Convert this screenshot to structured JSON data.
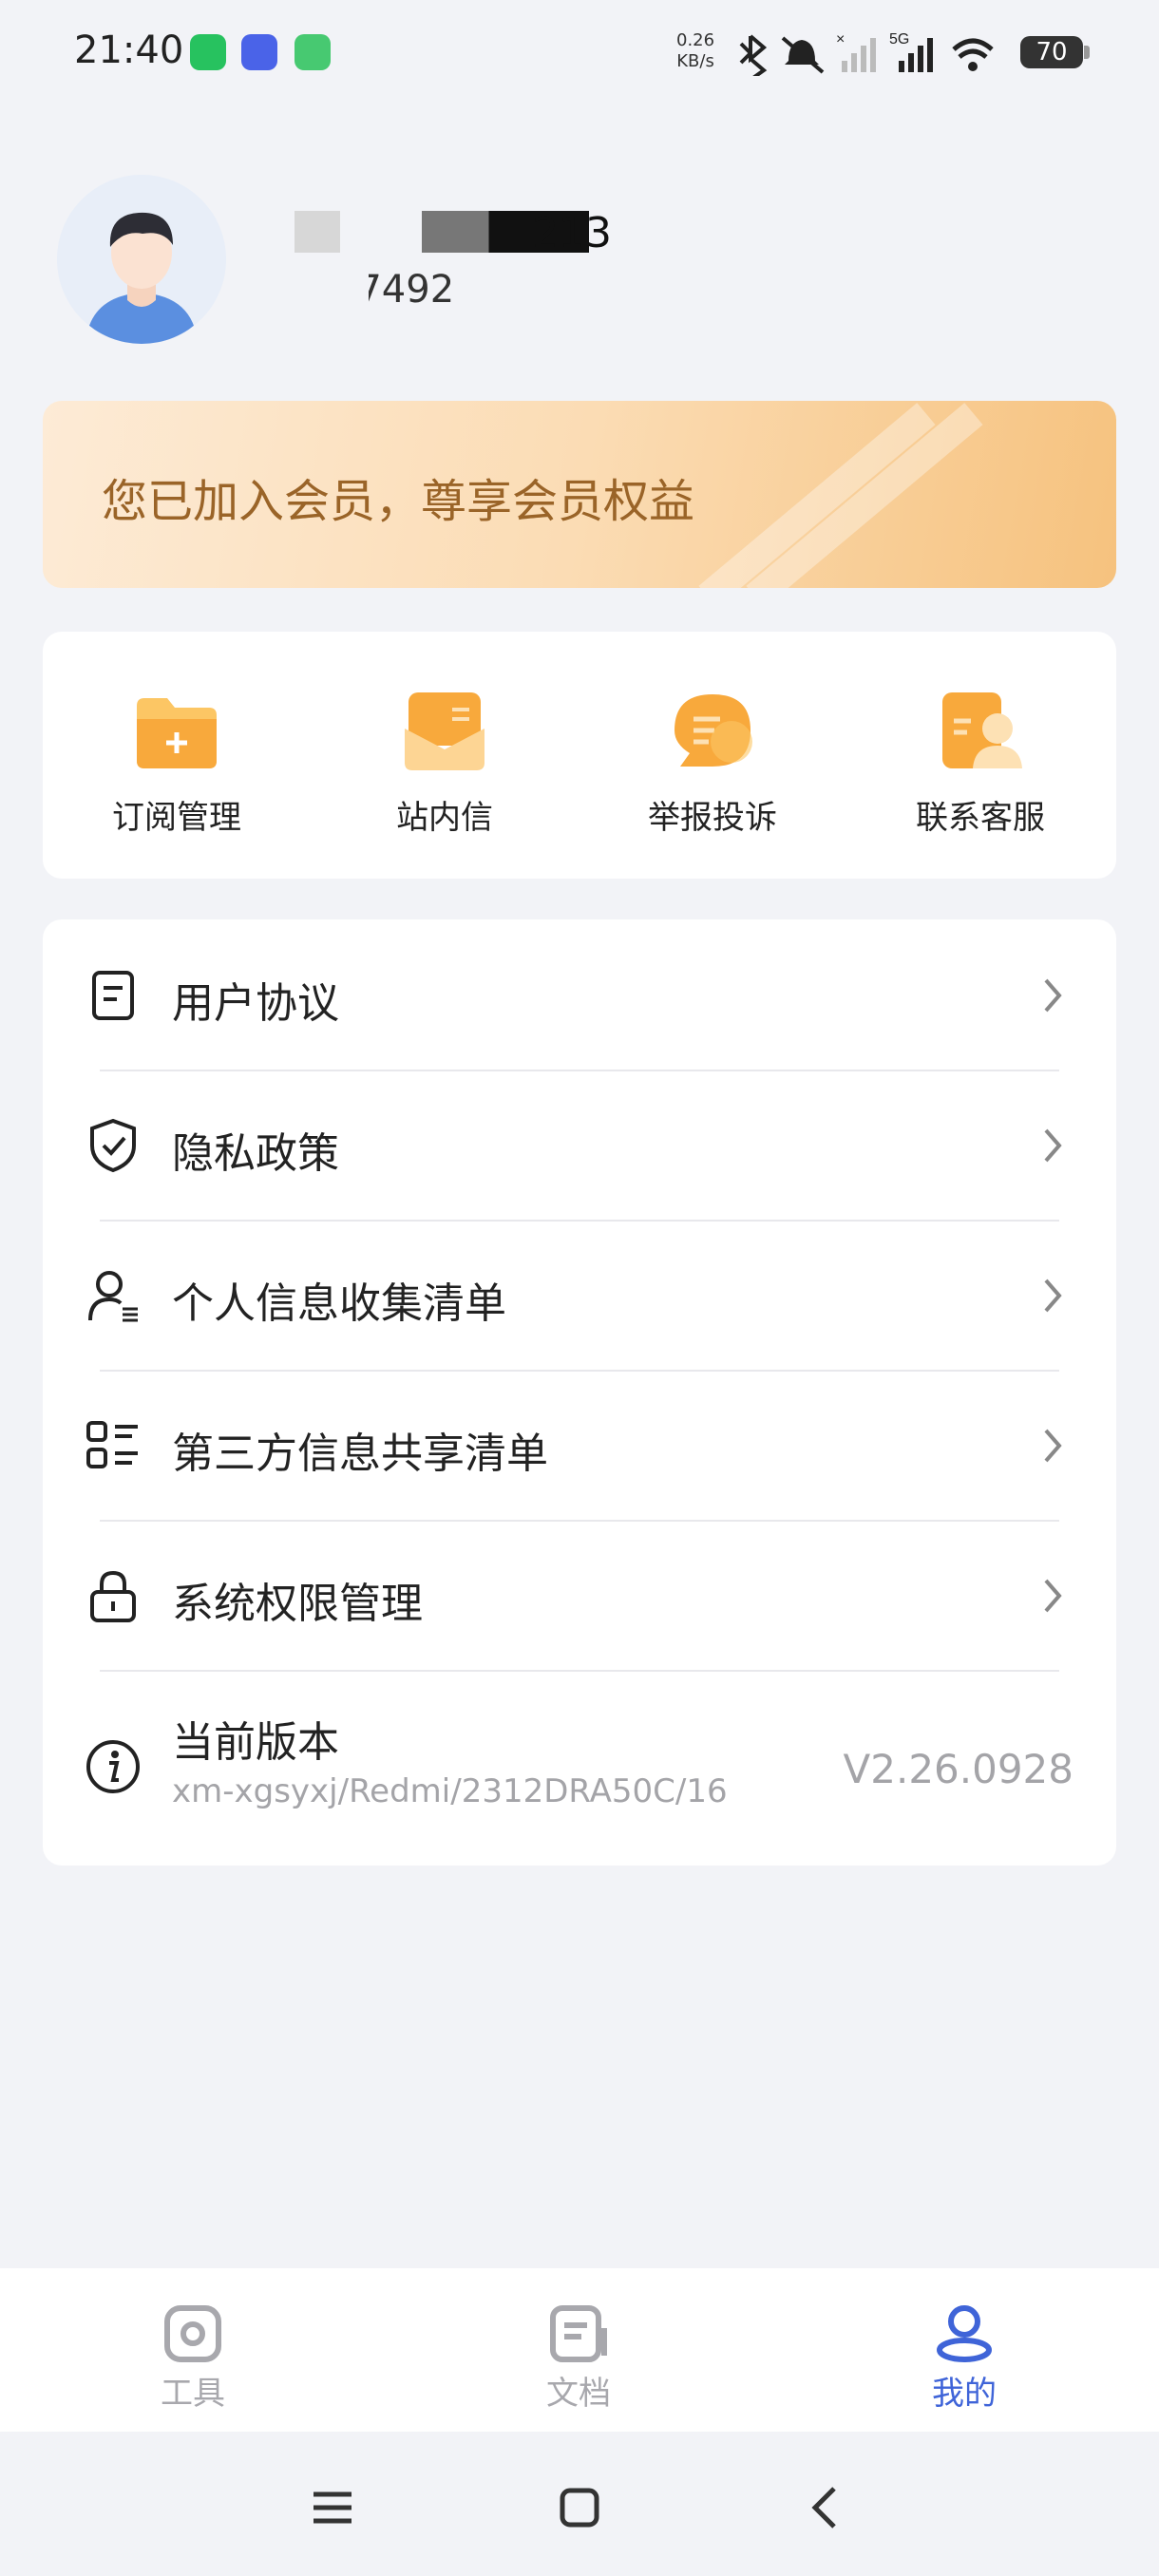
{
  "status_bar": {
    "time": "21:40",
    "net_speed_value": "0.26",
    "net_speed_unit": "KB/s",
    "battery": "70",
    "signal_label": "5G"
  },
  "profile": {
    "name_visible": "213",
    "phone_visible": "1337492"
  },
  "banner": {
    "text": "您已加入会员，尊享会员权益"
  },
  "actions": [
    {
      "label": "订阅管理",
      "icon": "folder-add-icon"
    },
    {
      "label": "站内信",
      "icon": "mail-icon"
    },
    {
      "label": "举报投诉",
      "icon": "chat-bubble-icon"
    },
    {
      "label": "联系客服",
      "icon": "customer-service-icon"
    }
  ],
  "menu": {
    "items": [
      {
        "label": "用户协议",
        "icon": "document-icon"
      },
      {
        "label": "隐私政策",
        "icon": "shield-check-icon"
      },
      {
        "label": "个人信息收集清单",
        "icon": "user-list-icon"
      },
      {
        "label": "第三方信息共享清单",
        "icon": "list-icon"
      },
      {
        "label": "系统权限管理",
        "icon": "lock-icon"
      }
    ],
    "version": {
      "title": "当前版本",
      "device": "xm-xgsyxj/Redmi/2312DRA50C/16",
      "number": "V2.26.0928"
    }
  },
  "tabs": [
    {
      "label": "工具",
      "icon": "tool-icon",
      "active": false
    },
    {
      "label": "文档",
      "icon": "document-tab-icon",
      "active": false
    },
    {
      "label": "我的",
      "icon": "profile-icon",
      "active": true
    }
  ],
  "colors": {
    "accent": "#3f64d8",
    "banner_text": "#9a6428",
    "icon_orange": "#f7a735"
  }
}
